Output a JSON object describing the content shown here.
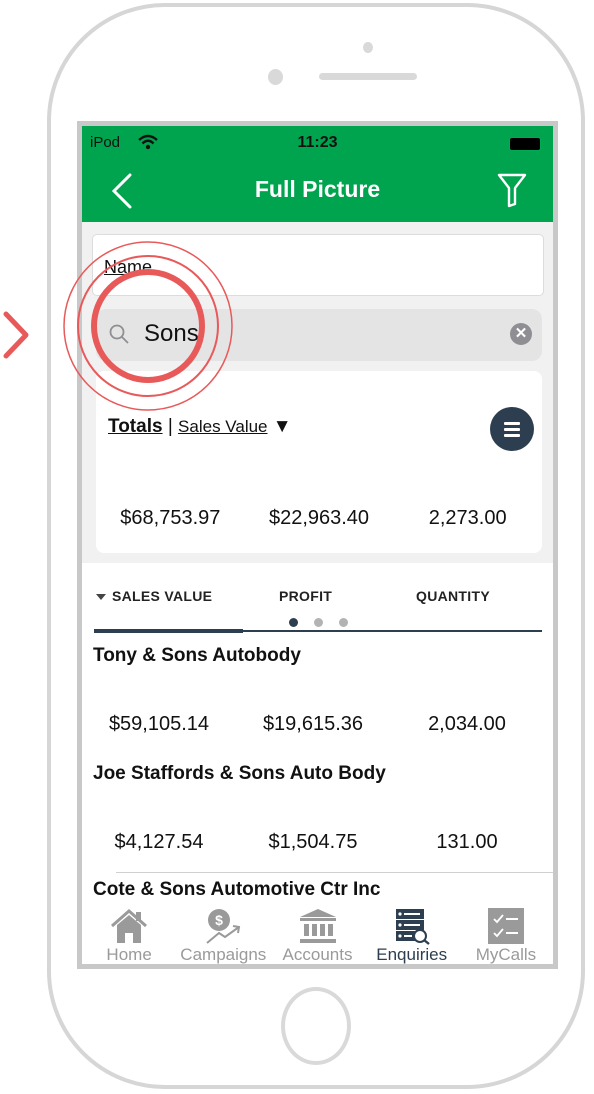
{
  "status_bar": {
    "carrier": "iPod",
    "time": "11:23"
  },
  "navbar": {
    "title": "Full Picture",
    "back_icon": "chevron-left-icon",
    "filter_icon": "filter-icon"
  },
  "name_field": {
    "label": "Name"
  },
  "search": {
    "value": "Sons",
    "clear_glyph": "✕"
  },
  "totals": {
    "label": "Totals",
    "separator": "|",
    "measure": "Sales Value",
    "caret": "▼",
    "values": [
      "$68,753.97",
      "$22,963.40",
      "2,273.00"
    ]
  },
  "tabs": {
    "items": [
      {
        "label": "SALES VALUE",
        "active": true
      },
      {
        "label": "PROFIT",
        "active": false
      },
      {
        "label": "QUANTITY",
        "active": false
      }
    ],
    "page_dots": {
      "count": 3,
      "current": 1
    }
  },
  "accounts": [
    {
      "name": "Tony & Sons Autobody",
      "sales_value": "$59,105.14",
      "profit": "$19,615.36",
      "quantity": "2,034.00"
    },
    {
      "name": "Joe Staffords & Sons Auto Body",
      "sales_value": "$4,127.54",
      "profit": "$1,504.75",
      "quantity": "131.00"
    },
    {
      "name": "Cote & Sons Automotive Ctr Inc"
    }
  ],
  "tabbar": {
    "items": [
      {
        "label": "Home",
        "icon": "home-icon",
        "active": false
      },
      {
        "label": "Campaigns",
        "icon": "campaigns-icon",
        "active": false
      },
      {
        "label": "Accounts",
        "icon": "accounts-icon",
        "active": false
      },
      {
        "label": "Enquiries",
        "icon": "enquiries-icon",
        "active": true
      },
      {
        "label": "MyCalls",
        "icon": "mycalls-icon",
        "active": false
      }
    ]
  },
  "colors": {
    "brand_green": "#00a34e",
    "accent_dark": "#2c3e50",
    "highlight_red": "#e85a5a"
  }
}
